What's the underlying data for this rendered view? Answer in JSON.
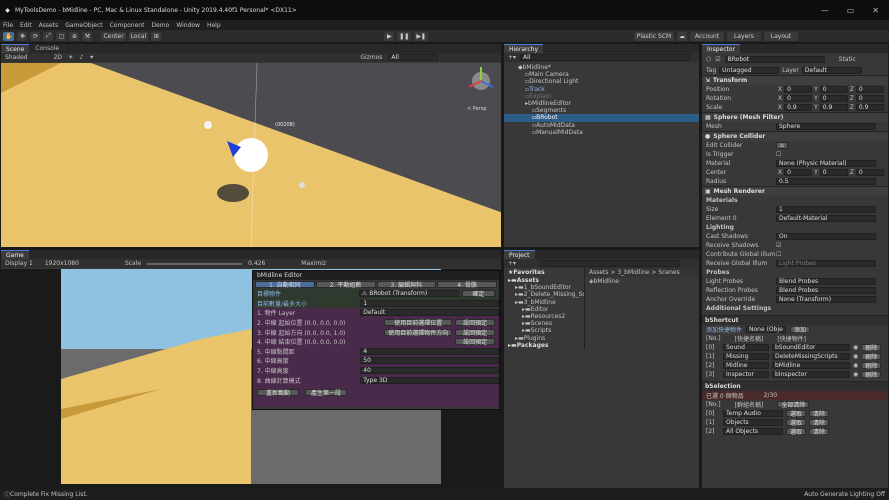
{
  "title": {
    "text": "MyToolsDemo - bMidline - PC, Mac & Linux Standalone - Unity 2019.4.40f1 Personal* <DX11>",
    "min": "—",
    "max": "▭",
    "close": "✕"
  },
  "menu": [
    "File",
    "Edit",
    "Assets",
    "GameObject",
    "Component",
    "Demo",
    "Window",
    "Help"
  ],
  "toolbar": {
    "center": "Center",
    "local": "Local",
    "plastic": "Plastic SCM",
    "account": "Account",
    "layers": "Layers",
    "layout": "Layout"
  },
  "scene": {
    "tabs": [
      "Scene",
      "Console"
    ],
    "shading": "Shaded",
    "mode2d": "2D",
    "gizmos": "Gizmos",
    "search": "All",
    "persp": "< Persp",
    "label": "(00208)"
  },
  "game": {
    "tab": "Game",
    "display": "Display 1",
    "resolution": "1920x1080",
    "scale_label": "Scale",
    "scale_value": "0.426",
    "maximize": "Maximiz"
  },
  "editor": {
    "title": "bMidline Editor",
    "tabs": [
      "1. 自動相同",
      "2. 平動組數",
      "3. 編輯與料",
      "4. 骨骼"
    ],
    "rows": [
      {
        "label": "目標物件",
        "value": "⚠ BRobot (Transform)",
        "btn": "確定"
      },
      {
        "label": "目前數量/最多大小",
        "value": "1",
        "btn": ""
      },
      {
        "label": "1. 物件 Layer",
        "value": "Default",
        "btn": ""
      },
      {
        "label": "2. 中線 起始位置 (0.0, 0.0, 0.0)",
        "value": "使用目前選擇位置",
        "btn": "設回預定"
      },
      {
        "label": "3. 中線 起始方向 (0.0, 0.0, 1.0)",
        "value": "使用目前選擇物件方向",
        "btn": "設回預定"
      },
      {
        "label": "4. 中線 結束位置 (0.0, 0.0, 0.0)",
        "value": "",
        "btn": "設回預定"
      },
      {
        "label": "5. 中線點間距",
        "value": "4",
        "btn": ""
      },
      {
        "label": "6. 中線高度",
        "value": "50",
        "btn": ""
      },
      {
        "label": "7. 中線高度",
        "value": "40",
        "btn": ""
      },
      {
        "label": "8. 曲線計算模式",
        "value": "Type 3D",
        "btn": ""
      }
    ],
    "buttons": [
      "重新載動",
      "產生第一段"
    ]
  },
  "hierarchy": {
    "tab": "Hierarchy",
    "search": "All",
    "items": [
      {
        "t": "bMidline*",
        "d": 0,
        "i": "◆"
      },
      {
        "t": "Main Camera",
        "d": 1,
        "i": "▫"
      },
      {
        "t": "Directional Light",
        "d": 1,
        "i": "▫"
      },
      {
        "t": "Track",
        "d": 1,
        "i": "▫",
        "blue": true
      },
      {
        "t": "Explain",
        "d": 1,
        "i": "▫",
        "dim": true
      },
      {
        "t": "bMidlineEditor",
        "d": 1,
        "i": "▸"
      },
      {
        "t": "Segments",
        "d": 2,
        "i": "▫"
      },
      {
        "t": "BRobot",
        "d": 2,
        "i": "▫",
        "sel": true
      },
      {
        "t": "AutoMidData",
        "d": 2,
        "i": "▫"
      },
      {
        "t": "ManualMidData",
        "d": 2,
        "i": "▫"
      }
    ]
  },
  "project": {
    "tab": "Project",
    "favorites": "Favorites",
    "breadcrumb": "Assets > 3_bMidline > Scenes",
    "file": "bMidline",
    "tree": [
      {
        "t": "Assets",
        "d": 0
      },
      {
        "t": "1_bSoundEditor",
        "d": 1
      },
      {
        "t": "2_Delete_Missing_Scrip",
        "d": 1
      },
      {
        "t": "3_bMidline",
        "d": 1
      },
      {
        "t": "Editor",
        "d": 2
      },
      {
        "t": "Resources2",
        "d": 2
      },
      {
        "t": "Scenes",
        "d": 2
      },
      {
        "t": "Scripts",
        "d": 2
      },
      {
        "t": "Plugins",
        "d": 1
      },
      {
        "t": "Packages",
        "d": 0
      }
    ]
  },
  "inspector": {
    "tab": "Inspector",
    "name": "BRobot",
    "static": "Static",
    "tag_label": "Tag",
    "tag": "Untagged",
    "layer_label": "Layer",
    "layer": "Default",
    "transform": "Transform",
    "tf_rows": [
      {
        "l": "Position",
        "x": "0",
        "y": "0",
        "z": "0"
      },
      {
        "l": "Rotation",
        "x": "0",
        "y": "0",
        "z": "0"
      },
      {
        "l": "Scale",
        "x": "0.9",
        "y": "0.9",
        "z": "0.9"
      }
    ],
    "meshfilter": "Sphere (Mesh Filter)",
    "mesh_label": "Mesh",
    "mesh": "Sphere",
    "collider": "Sphere Collider",
    "edit_collider": "Edit Collider",
    "is_trigger": "Is Trigger",
    "material_label": "Material",
    "material": "None (Physic Material)",
    "center_label": "Center",
    "cx": "0",
    "cy": "0",
    "cz": "0",
    "radius_label": "Radius",
    "radius": "0.5",
    "renderer": "Mesh Renderer",
    "materials": "Materials",
    "size_label": "Size",
    "size": "1",
    "elem_label": "Element 0",
    "elem": "Default-Material",
    "lighting": "Lighting",
    "cast_label": "Cast Shadows",
    "cast": "On",
    "receive_label": "Receive Shadows",
    "contrib_label": "Contribute Global Illum",
    "receive_gi_label": "Receive Global Illum",
    "receive_gi": "Light Probes",
    "probes": "Probes",
    "lp_label": "Light Probes",
    "lp": "Blend Probes",
    "rp_label": "Reflection Probes",
    "rp": "Blend Probes",
    "anchor_label": "Anchor Override",
    "anchor": "None (Transform)",
    "additional": "Additional Settings"
  },
  "shortcut": {
    "title": "bShortcut",
    "add_label": "添加快捷物件",
    "none": "None (Obje",
    "add_btn": "添加",
    "cols": [
      "[No.]",
      "[快捷名稱]",
      "[快捷物件]"
    ],
    "rows": [
      {
        "no": "[0]",
        "name": "Sound",
        "obj": "bSoundEditor"
      },
      {
        "no": "[1]",
        "name": "Missing",
        "obj": "DeleteMissingScripts"
      },
      {
        "no": "[2]",
        "name": "Midline",
        "obj": "bMidline"
      },
      {
        "no": "[3]",
        "name": "Inspector",
        "obj": "bInspector"
      }
    ],
    "del": "刪除"
  },
  "selection": {
    "title": "bSelection",
    "count_label": "已選 0 個物品",
    "count": "2/30",
    "clear": "全部清除",
    "cols": [
      "[No.]",
      "[群組名稱]"
    ],
    "rows": [
      {
        "no": "[0]",
        "name": "Temp Audio"
      },
      {
        "no": "[1]",
        "name": "Objects"
      },
      {
        "no": "[2]",
        "name": "All Objects"
      }
    ],
    "b1": "選取",
    "b2": "清除"
  },
  "status": {
    "left": "Complete Fix Missing List.",
    "right": "Auto Generate Lighting Off"
  },
  "colors": {
    "accent": "#4c7bd9",
    "selection": "#2c5d87",
    "yellow": "#e9c46a",
    "purple": "#4a2a4a"
  }
}
